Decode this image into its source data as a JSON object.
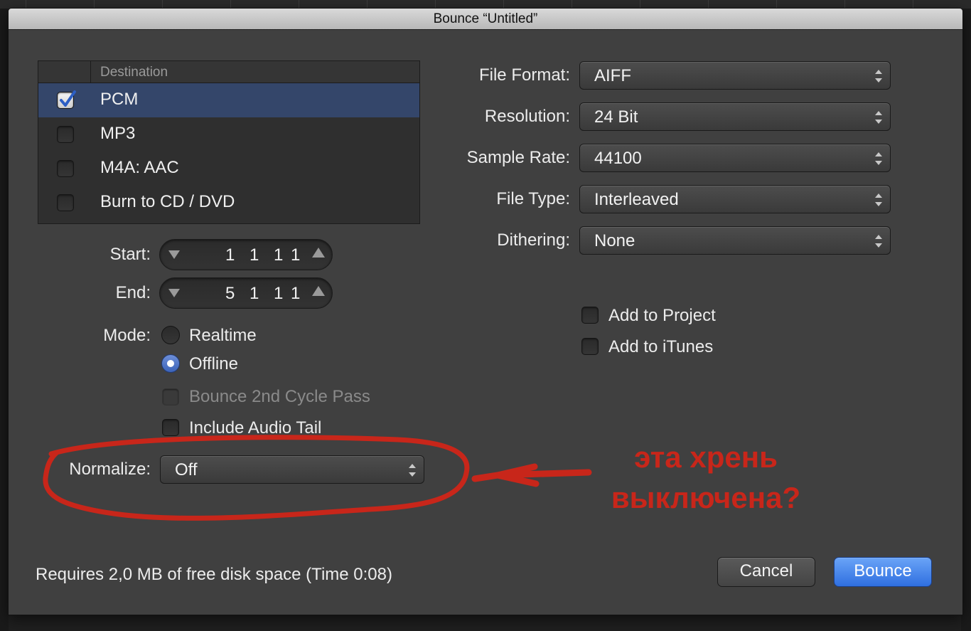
{
  "dialog": {
    "title": "Bounce “Untitled”"
  },
  "destination": {
    "header": "Destination",
    "items": [
      {
        "label": "PCM",
        "checked": true
      },
      {
        "label": "MP3",
        "checked": false
      },
      {
        "label": "M4A: AAC",
        "checked": false
      },
      {
        "label": "Burn to CD / DVD",
        "checked": false
      }
    ]
  },
  "range": {
    "start_label": "Start:",
    "start_position": "1 1 1",
    "start_tick": "1",
    "end_label": "End:",
    "end_position": "5 1 1",
    "end_tick": "1"
  },
  "mode": {
    "label": "Mode:",
    "options": [
      {
        "label": "Realtime",
        "selected": false
      },
      {
        "label": "Offline",
        "selected": true
      }
    ]
  },
  "options": {
    "bounce_2nd_cycle": "Bounce 2nd Cycle Pass",
    "include_audio_tail": "Include Audio Tail"
  },
  "normalize": {
    "label": "Normalize:",
    "value": "Off"
  },
  "settings": {
    "file_format_label": "File Format:",
    "file_format": "AIFF",
    "resolution_label": "Resolution:",
    "resolution": "24 Bit",
    "sample_rate_label": "Sample Rate:",
    "sample_rate": "44100",
    "file_type_label": "File Type:",
    "file_type": "Interleaved",
    "dithering_label": "Dithering:",
    "dithering": "None"
  },
  "add": {
    "to_project": "Add to Project",
    "to_itunes": "Add to iTunes"
  },
  "footer": {
    "status": "Requires 2,0 MB of free disk space  (Time 0:08)"
  },
  "buttons": {
    "cancel": "Cancel",
    "bounce": "Bounce"
  },
  "annotation": {
    "line1": "эта хрень",
    "line2": "выключена?",
    "color": "#c8261a"
  },
  "colors": {
    "accent": "#3c63b9",
    "selection": "#34466a"
  }
}
